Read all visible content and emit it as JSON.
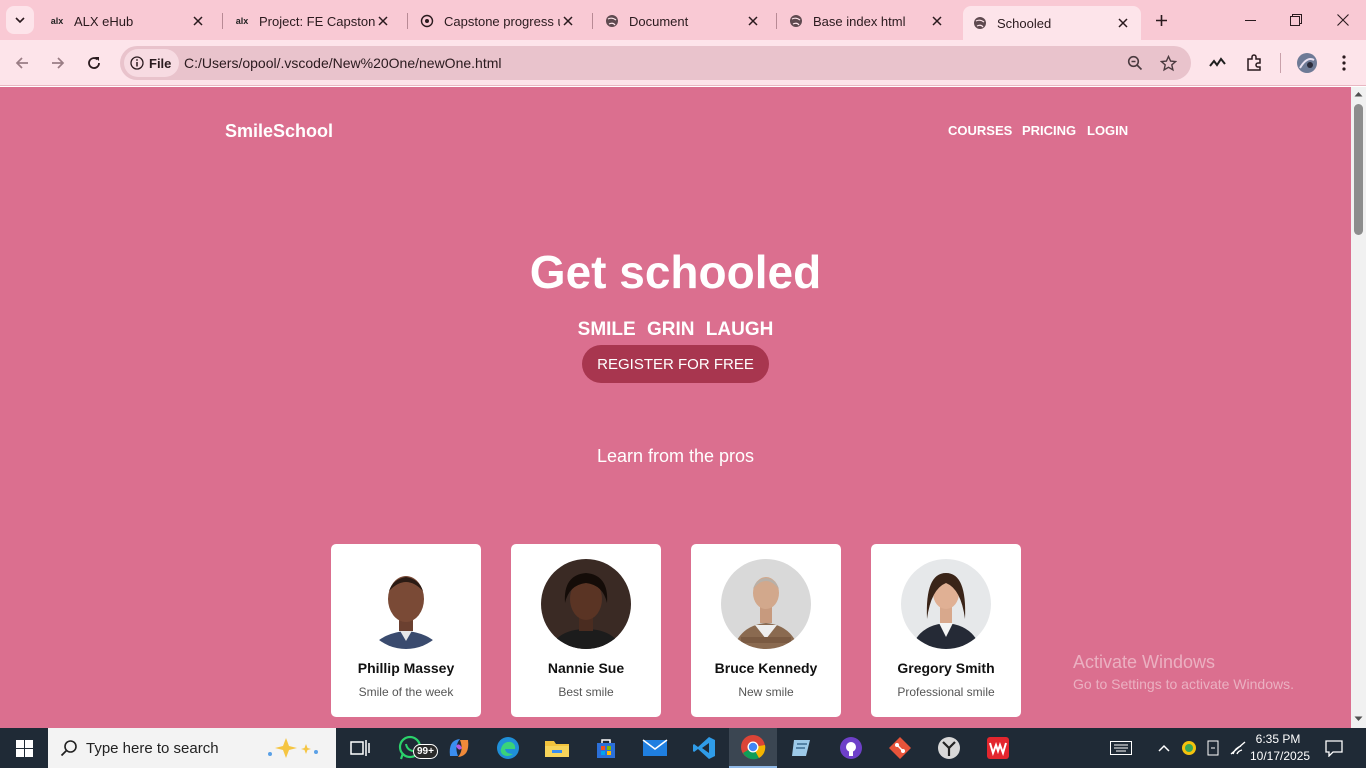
{
  "browser": {
    "tabs": [
      {
        "favicon": "alx",
        "title": "ALX eHub"
      },
      {
        "favicon": "alx",
        "title": "Project: FE Capstone P"
      },
      {
        "favicon": "chatgpt-icon",
        "title": "Capstone progress up"
      },
      {
        "favicon": "globe-icon",
        "title": "Document"
      },
      {
        "favicon": "globe-icon",
        "title": "Base index html"
      },
      {
        "favicon": "globe-icon",
        "title": "Schooled"
      }
    ],
    "active_tab": 5,
    "address_chip": "File",
    "url": "C:/Users/opool/.vscode/New%20One/newOne.html"
  },
  "site": {
    "brand": "SmileSchool",
    "nav": [
      "COURSES",
      "PRICING",
      "LOGIN"
    ],
    "hero_title": "Get schooled",
    "hero_subtitle": "SMILE  GRIN  LAUGH",
    "register_label": "REGISTER FOR FREE",
    "section_title": "Learn from the pros",
    "cards": [
      {
        "name": "Phillip Massey",
        "role": "Smile of the week"
      },
      {
        "name": "Nannie Sue",
        "role": "Best smile"
      },
      {
        "name": "Bruce Kennedy",
        "role": "New smile"
      },
      {
        "name": "Gregory Smith",
        "role": "Professional smile"
      }
    ],
    "colors": {
      "page_bg": "#db6f8f",
      "button_bg": "#a8364f",
      "card_bg": "#ffffff"
    }
  },
  "watermark": {
    "line1": "Activate Windows",
    "line2": "Go to Settings to activate Windows."
  },
  "taskbar": {
    "search_placeholder": "Type here to search",
    "whatsapp_badge": "99+",
    "time": "6:35 PM",
    "date": "10/17/2025"
  }
}
